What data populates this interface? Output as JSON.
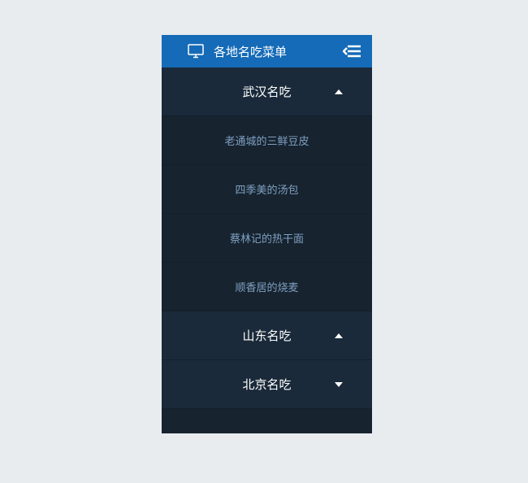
{
  "header": {
    "title": "各地名吃菜单"
  },
  "menu": [
    {
      "label": "武汉名吃",
      "expanded": true,
      "items": [
        "老通城的三鲜豆皮",
        "四季美的汤包",
        "蔡林记的热干面",
        "顺香居的烧麦"
      ]
    },
    {
      "label": "山东名吃",
      "expanded": true,
      "items": []
    },
    {
      "label": "北京名吃",
      "expanded": false,
      "items": []
    }
  ]
}
